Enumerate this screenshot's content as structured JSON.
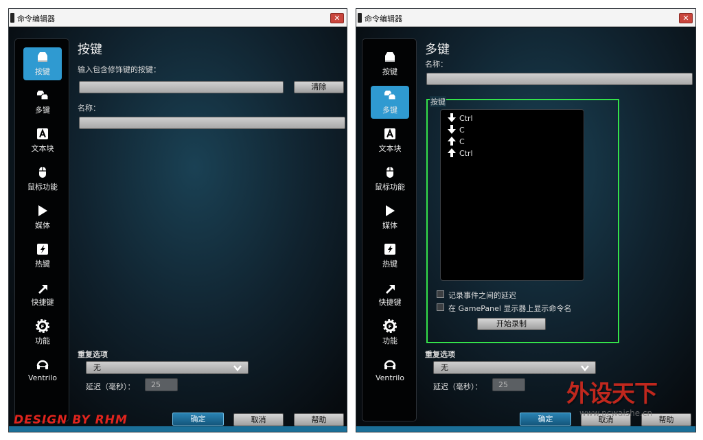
{
  "window_title": "命令编辑器",
  "close_glyph": "✕",
  "nav_items": [
    {
      "label": "按键",
      "icon": "keycap-icon"
    },
    {
      "label": "多键",
      "icon": "multikey-icon"
    },
    {
      "label": "文本块",
      "icon": "text-block-icon"
    },
    {
      "label": "鼠标功能",
      "icon": "mouse-icon"
    },
    {
      "label": "媒体",
      "icon": "play-icon"
    },
    {
      "label": "热键",
      "icon": "hotkey-icon"
    },
    {
      "label": "快捷键",
      "icon": "shortcut-arrow-icon"
    },
    {
      "label": "功能",
      "icon": "function-gear-icon"
    },
    {
      "label": "Ventrilo",
      "icon": "ventrilo-headset-icon"
    }
  ],
  "left_panel": {
    "active_nav": 0,
    "title": "按键",
    "input_label": "输入包含修饰键的按键：",
    "input_value": "",
    "clear_button": "清除",
    "name_label": "名称：",
    "name_value": ""
  },
  "right_panel": {
    "active_nav": 1,
    "title": "多键",
    "name_label": "名称：",
    "name_value": "",
    "keys_label": "按键",
    "keys": [
      {
        "direction": "down",
        "key": "Ctrl"
      },
      {
        "direction": "down",
        "key": "C"
      },
      {
        "direction": "up",
        "key": "C"
      },
      {
        "direction": "up",
        "key": "Ctrl"
      }
    ],
    "record_delay_label": "记录事件之间的延迟",
    "show_on_gamepanel_label": "在 GamePanel 显示器上显示命令名",
    "record_delay_checked": false,
    "show_on_gamepanel_checked": false,
    "start_record_button": "开始录制",
    "highlight_color": "#34e24a"
  },
  "repeat": {
    "label": "重复选项",
    "selected": "无",
    "delay_label": "延迟（毫秒）：",
    "delay_value": "25"
  },
  "buttons": {
    "ok": "确定",
    "cancel": "取消",
    "help": "帮助"
  },
  "overlay": {
    "design_credit": "DESIGN BY RHM",
    "site_logo": "外设天下",
    "site_url": "www.pcwaishe.cn"
  },
  "colors": {
    "accent": "#2f9ad1",
    "background": "#0b0f14",
    "band": "#1b6f98"
  }
}
